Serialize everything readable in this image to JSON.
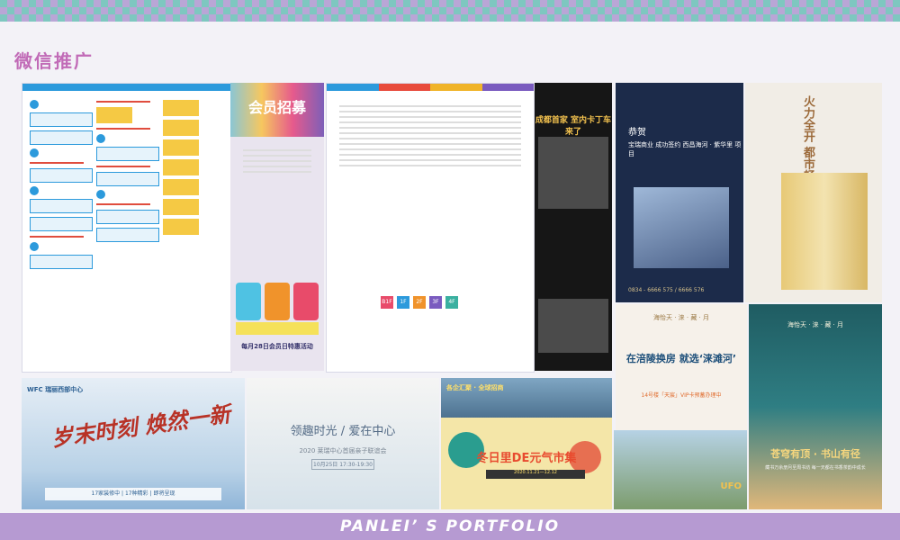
{
  "page": {
    "section_title": "微信推广",
    "footer_text": "PANLEI’ S PORTFOLIO",
    "colors": {
      "accent_purple": "#b69ad2",
      "title_pink": "#c16bb7",
      "checker_teal": "#7ec7c0"
    }
  },
  "cards": {
    "membership": {
      "title": "会员招募",
      "subtitle": "每月28日会员日特惠活动"
    },
    "racing": {
      "heading": "成都首家 室内卡丁车来了"
    },
    "congrats": {
      "heading": "恭贺",
      "body": "宝瑞商业 成功签约 西昌海河 · 紫华里 项目",
      "tel": "0834 - 6666 575 / 6666 576"
    },
    "fire": {
      "vertical_text": "火力全开 都市畅赎首站"
    },
    "relocate": {
      "logo": "海怡天 · 涞 · 藏 · 月",
      "headline": "在涪陵换房 就选‘涞滩河’",
      "date": "14号楼「天宸」VIP卡预蓄办理中"
    },
    "library": {
      "logo": "海怡天 · 涞 · 藏 · 月",
      "slogan": "苍穹有顶 · 书山有径",
      "sub": "藏书万余册月至周书坊 每一天都在书香茶韵中成长"
    },
    "wfc": {
      "logo": "WFC 瑞丽西部中心",
      "headline": "岁末时刻 焕然一新",
      "bar": "17家装修中 | 17种精彩 | 即将呈现"
    },
    "parent": {
      "headline": "领趣时光 / 爱在中心",
      "sub": "2020 莱瑞中心首届亲子联谊会",
      "date": "10月25日 17:30-19:30"
    },
    "market": {
      "city_text": "各企汇聚 · 全球招商",
      "headline": "冬日里DE元气市集",
      "date": "2020.11.21—12.12"
    },
    "ufo": {
      "label": "UFO"
    }
  }
}
